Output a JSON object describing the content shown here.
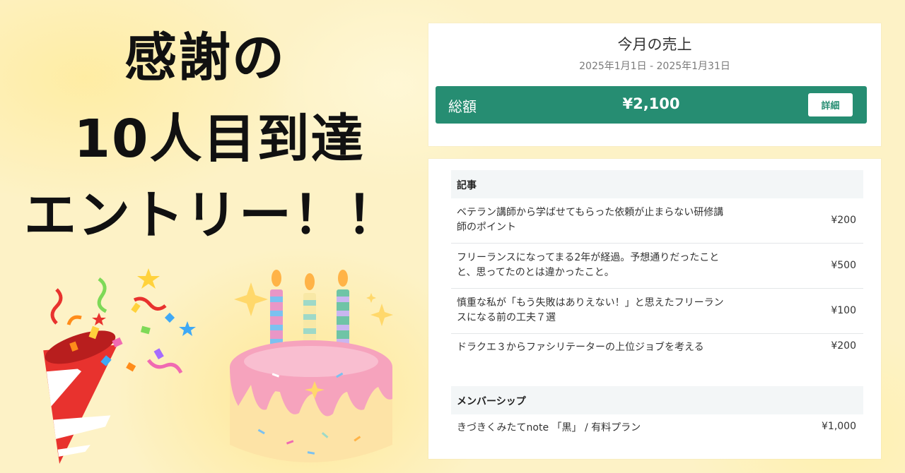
{
  "banner": {
    "line1": "感謝の",
    "line2": "10人目到達",
    "line3": "エントリー！！"
  },
  "sales": {
    "title": "今月の売上",
    "period": "2025年1月1日 - 2025年1月31日",
    "total_label": "総額",
    "total_value": "¥2,100",
    "detail_button": "詳細"
  },
  "articles": {
    "heading": "記事",
    "items": [
      {
        "title": "ベテラン講師から学ばせてもらった依頼が止まらない研修講師のポイント",
        "price": "¥200"
      },
      {
        "title": "フリーランスになってまる2年が経過。予想通りだったことと、思ってたのとは違かったこと。",
        "price": "¥500"
      },
      {
        "title": "慎重な私が「もう失敗はありえない！」と思えたフリーランスになる前の工夫７選",
        "price": "¥100"
      },
      {
        "title": "ドラクエ３からファシリテーターの上位ジョブを考える",
        "price": "¥200"
      }
    ]
  },
  "membership": {
    "heading": "メンバーシップ",
    "items": [
      {
        "title": "きづきくみたてnote 「黒」 / 有料プラン",
        "price": "¥1,000"
      }
    ]
  },
  "colors": {
    "accent": "#268d72",
    "background": "#fdf2c6",
    "section_bg": "#f3f6f7"
  },
  "icons": [
    "party-popper-icon",
    "birthday-cake-icon",
    "sparkle-icon"
  ]
}
